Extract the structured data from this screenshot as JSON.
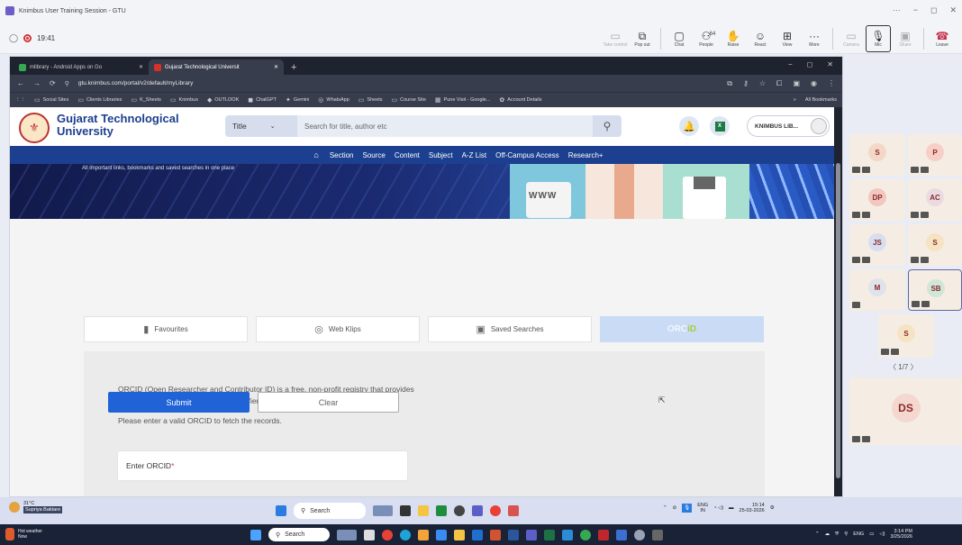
{
  "teams": {
    "window_title": "Knimbus User Training Session - GTU",
    "recording_time": "19:41",
    "toolbar": [
      {
        "label": "Take control",
        "icon": "take-control-icon",
        "glyph": "▭",
        "dim": true
      },
      {
        "label": "Pop out",
        "icon": "pop-out-icon",
        "glyph": "⧉",
        "dim": false
      },
      {
        "label": "Chat",
        "icon": "chat-icon",
        "glyph": "▢",
        "dim": false
      },
      {
        "label": "People",
        "icon": "people-icon",
        "glyph": "⚇",
        "dim": false,
        "count": "64"
      },
      {
        "label": "Raise",
        "icon": "raise-hand-icon",
        "glyph": "✋",
        "dim": false
      },
      {
        "label": "React",
        "icon": "react-icon",
        "glyph": "☺",
        "dim": false
      },
      {
        "label": "View",
        "icon": "view-icon",
        "glyph": "⊞",
        "dim": false
      },
      {
        "label": "More",
        "icon": "more-icon",
        "glyph": "···",
        "dim": false
      },
      {
        "label": "Camera",
        "icon": "camera-icon",
        "glyph": "▭",
        "dim": true
      },
      {
        "label": "Mic",
        "icon": "mic-off-icon",
        "glyph": "🎙",
        "dim": false
      },
      {
        "label": "Share",
        "icon": "share-icon",
        "glyph": "▣",
        "dim": true
      },
      {
        "label": "Leave",
        "icon": "leave-icon",
        "glyph": "☎",
        "dim": false
      }
    ],
    "window_controls": [
      "···",
      "−",
      "◻",
      "✕"
    ],
    "participants": [
      {
        "initials": "S"
      },
      {
        "initials": "P"
      },
      {
        "initials": "DP"
      },
      {
        "initials": "AC"
      },
      {
        "initials": "JS"
      },
      {
        "initials": "S"
      },
      {
        "initials": "M"
      },
      {
        "initials": "SB"
      },
      {
        "initials": "S"
      },
      {
        "initials": "DS"
      }
    ],
    "pager": "〈 1/7 〉"
  },
  "browser": {
    "tabs": [
      {
        "label": "mlibrary - Android Apps on Go",
        "close": "✕",
        "color": "#34a853"
      },
      {
        "label": "Gujarat Technological Universit",
        "close": "✕",
        "color": "#d93025"
      }
    ],
    "new_tab": "+",
    "window_controls": [
      "−",
      "◻",
      "✕"
    ],
    "url": "gtu.knimbus.com/portal/v2/default/myLibrary",
    "nav_glyphs": [
      "←",
      "→",
      "⟳"
    ],
    "bookmarks": [
      "Social Sites",
      "Clients Libraries",
      "K_Sheets",
      "Knimbus",
      "OUTLOOK",
      "ChatGPT",
      "Gemini",
      "WhatsApp",
      "Sheets",
      "Course Site",
      "Pune Visit - Google...",
      "Account Details"
    ],
    "bookmarks_more": "»",
    "all_bookmarks": "All Bookmarks"
  },
  "site": {
    "university_line1": "Gujarat Technological",
    "university_line2": "University",
    "search_filter": "Title",
    "search_placeholder": "Search for title, author etc",
    "user_label": "KNIMBUS LIB...",
    "nav": [
      "Section",
      "Source",
      "Content",
      "Subject",
      "A-Z List",
      "Off-Campus Access",
      "Research+"
    ],
    "banner_tagline": "All important links, bookmarks and saved searches in one place",
    "banner_www": "WWW",
    "library_tabs": [
      "Favourites",
      "Web Klips",
      "Saved Searches",
      "ORCID"
    ],
    "orcid_description": "ORCID (Open Researcher and Contributor ID) is a free, non-profit registry that provides researchers with a unique digital identifier.",
    "orcid_hint": "Please enter a valid ORCID to fetch the records.",
    "orcid_input_label": "Enter ORCID",
    "orcid_required": "*",
    "submit_label": "Submit",
    "clear_label": "Clear"
  },
  "taskbar_inner": {
    "search": "Search",
    "weather": "31°C",
    "presenter": "Supriya Baktare",
    "lang": "ENG",
    "lang2": "IN",
    "time": "15:14",
    "date": "25-03-2026"
  },
  "taskbar_outer": {
    "weather": "Hot weather",
    "weather_sub": "Now",
    "search": "Search",
    "lang": "ENG",
    "time": "3:14 PM",
    "date": "3/25/2026"
  }
}
